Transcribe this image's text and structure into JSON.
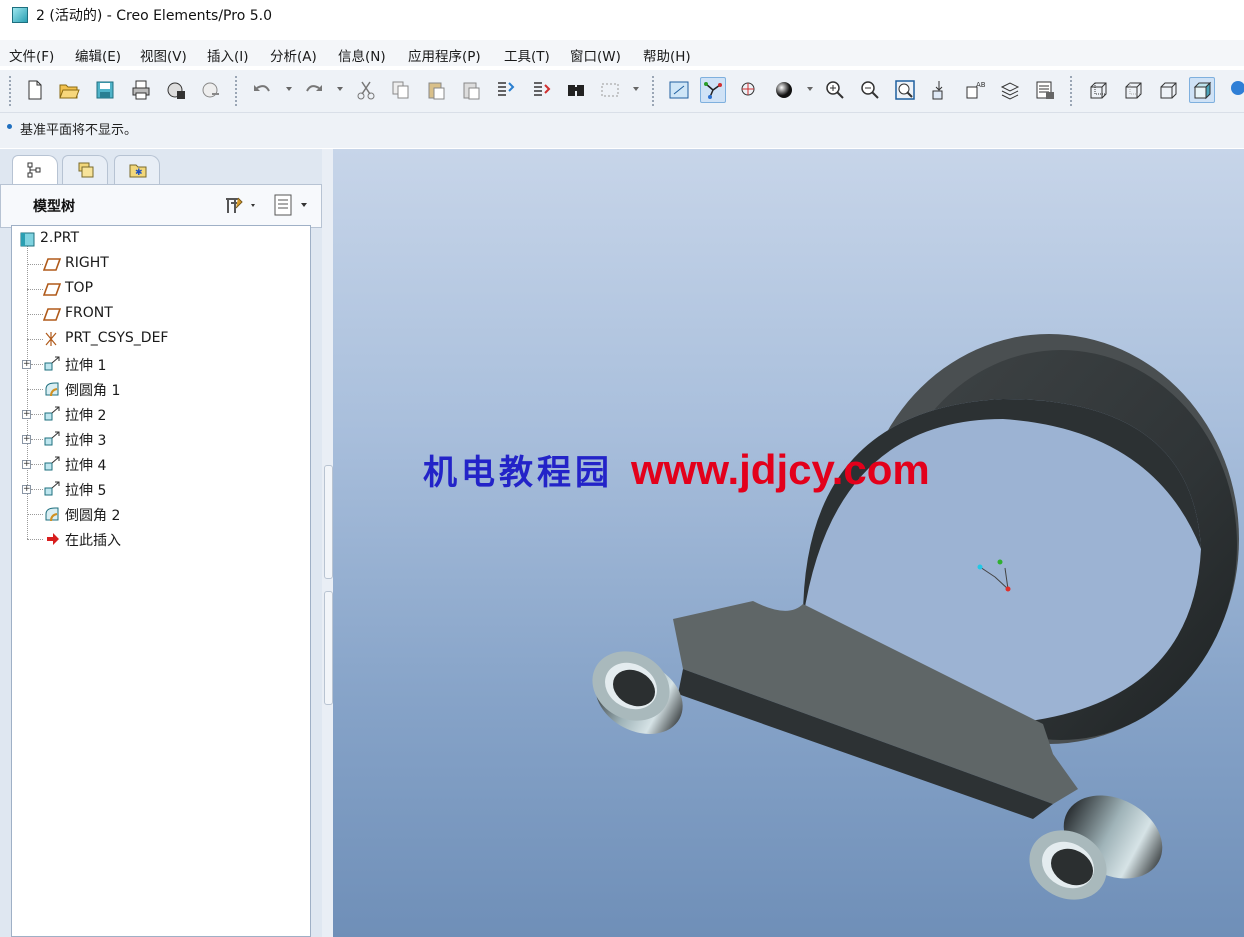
{
  "window": {
    "title": "2 (活动的) - Creo Elements/Pro 5.0"
  },
  "menu": [
    "文件(F)",
    "编辑(E)",
    "视图(V)",
    "插入(I)",
    "分析(A)",
    "信息(N)",
    "应用程序(P)",
    "工具(T)",
    "窗口(W)",
    "帮助(H)"
  ],
  "toolbar": {
    "icons": [
      "new-file-icon",
      "open-folder-icon",
      "save-icon",
      "print-icon",
      "email-icon",
      "email-link-icon",
      "undo-icon",
      "redo-icon",
      "cut-icon",
      "copy-icon",
      "paste-icon",
      "paste-special-icon",
      "regenerate-icon",
      "regenerate-manager-icon",
      "find-icon",
      "selection-box-icon",
      "refit-icon",
      "datum-display-icon",
      "spin-center-icon",
      "shading-icon",
      "zoom-in-icon",
      "zoom-out-icon",
      "zoom-fit-icon",
      "orient-icon",
      "saved-views-icon",
      "layers-icon",
      "view-manager-icon",
      "wireframe-icon",
      "hidden-line-icon",
      "no-hidden-icon",
      "shaded-icon",
      "sphere-icon"
    ]
  },
  "message": {
    "text": "基准平面将不显示。"
  },
  "model_tree": {
    "header": "模型树",
    "items": [
      {
        "label": "2.PRT",
        "icon": "part-icon",
        "expandable": false,
        "level": 0
      },
      {
        "label": "RIGHT",
        "icon": "datum-plane-icon",
        "expandable": false,
        "level": 1
      },
      {
        "label": "TOP",
        "icon": "datum-plane-icon",
        "expandable": false,
        "level": 1
      },
      {
        "label": "FRONT",
        "icon": "datum-plane-icon",
        "expandable": false,
        "level": 1
      },
      {
        "label": "PRT_CSYS_DEF",
        "icon": "csys-icon",
        "expandable": false,
        "level": 1
      },
      {
        "label": "拉伸 1",
        "icon": "extrude-icon",
        "expandable": true,
        "level": 1
      },
      {
        "label": "倒圆角 1",
        "icon": "round-icon",
        "expandable": false,
        "level": 1
      },
      {
        "label": "拉伸 2",
        "icon": "extrude-icon",
        "expandable": true,
        "level": 1
      },
      {
        "label": "拉伸 3",
        "icon": "extrude-icon",
        "expandable": true,
        "level": 1
      },
      {
        "label": "拉伸 4",
        "icon": "extrude-icon",
        "expandable": true,
        "level": 1
      },
      {
        "label": "拉伸 5",
        "icon": "extrude-icon",
        "expandable": true,
        "level": 1
      },
      {
        "label": "倒圆角 2",
        "icon": "round-icon",
        "expandable": false,
        "level": 1
      },
      {
        "label": "在此插入",
        "icon": "insert-here-icon",
        "expandable": false,
        "level": 1
      }
    ]
  },
  "watermark": {
    "cn": "机电教程园",
    "url": "www.jdjcy.com",
    "cn_color": "#2323c8",
    "url_color": "#e3001b"
  },
  "colors": {
    "accent": "#1f6fbf",
    "viewport_top": "#c7d5e9",
    "viewport_bottom": "#6f8fb8",
    "part": "#5b6062"
  }
}
